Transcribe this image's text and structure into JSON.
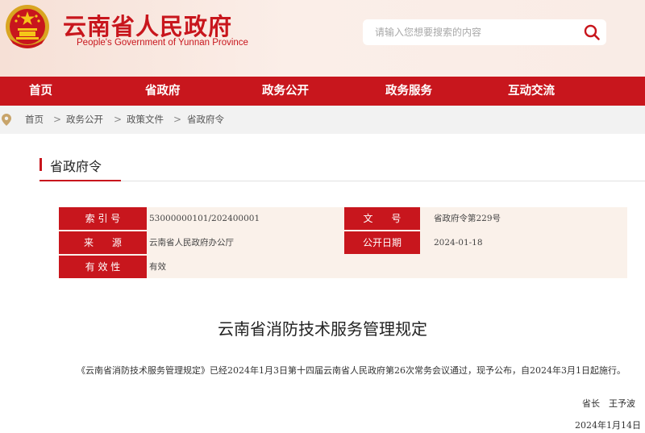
{
  "header": {
    "title_cn": "云南省人民政府",
    "title_en": "People's Government of Yunnan Province",
    "search_placeholder": "请输入您想要搜索的内容"
  },
  "nav": {
    "items": [
      {
        "label": "首页"
      },
      {
        "label": "省政府"
      },
      {
        "label": "政务公开"
      },
      {
        "label": "政务服务"
      },
      {
        "label": "互动交流"
      }
    ]
  },
  "breadcrumb": {
    "items": [
      {
        "label": "首页"
      },
      {
        "label": "政务公开"
      },
      {
        "label": "政策文件"
      },
      {
        "label": "省政府令"
      }
    ],
    "separator": ">"
  },
  "section": {
    "title": "省政府令"
  },
  "info": {
    "index_label": "索 引 号",
    "index_value": "53000000101/202400001",
    "docno_label": "文      号",
    "docno_value": "省政府令第229号",
    "source_label": "来      源",
    "source_value": "云南省人民政府办公厅",
    "date_label": "公开日期",
    "date_value": "2024-01-18",
    "validity_label": "有 效 性",
    "validity_value": "有效"
  },
  "document": {
    "title": "云南省消防技术服务管理规定",
    "body": "《云南省消防技术服务管理规定》已经2024年1月3日第十四届云南省人民政府第26次常务会议通过，现予公布，自2024年3月1日起施行。",
    "signature": "省长　王予波",
    "date": "2024年1月14日"
  },
  "colors": {
    "brand_red": "#c8161d",
    "header_bg": "#f6e0d6",
    "info_bg": "#faf1ea",
    "breadcrumb_bg": "#f2f2f2"
  },
  "icons": {
    "emblem": "national-emblem-icon",
    "search": "search-icon",
    "location": "location-pin-icon"
  }
}
